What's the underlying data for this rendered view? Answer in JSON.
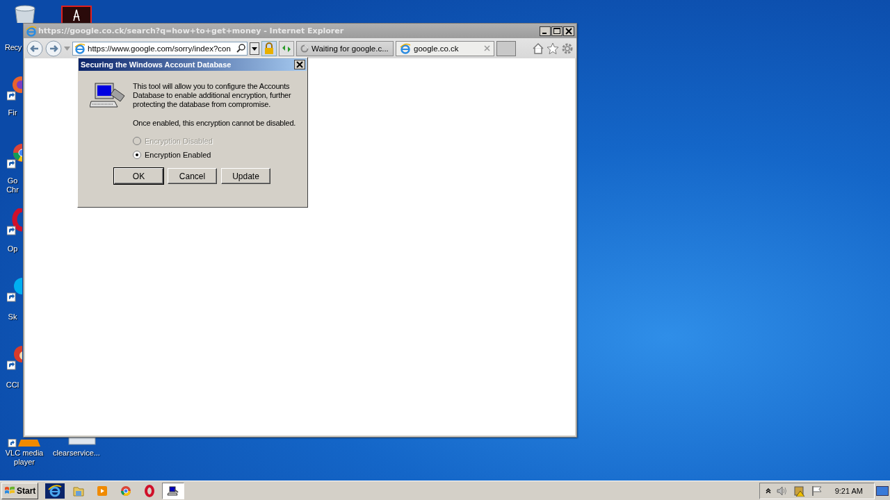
{
  "desktop_icons": [
    {
      "kind": "bin",
      "label": "Recy"
    },
    {
      "kind": "app"
    },
    {
      "kind": "firefox",
      "label": "Fir"
    },
    {
      "kind": "chrome",
      "label": "Go Chr"
    },
    {
      "kind": "opera",
      "label": "Op"
    },
    {
      "kind": "skype",
      "label": "Sk"
    },
    {
      "kind": "ccleaner",
      "label": "CCl"
    },
    {
      "kind": "vlc",
      "label": "VLC media player"
    },
    {
      "kind": "file",
      "label": "clearservice..."
    }
  ],
  "browser": {
    "title": "https://google.co.ck/search?q=how+to+get+money - Internet Explorer",
    "address": "https://www.google.com/sorry/index?con",
    "tabs": [
      {
        "kind": "loading",
        "label": "Waiting for google.c...",
        "selected": false
      },
      {
        "kind": "page",
        "label": "google.co.ck",
        "selected": true
      }
    ]
  },
  "dialog": {
    "title": "Securing the Windows Account Database",
    "paragraphs": [
      "This tool will allow you to configure the Accounts Database to enable additional encryption, further protecting the database from compromise.",
      "Once enabled, this encryption cannot be disabled."
    ],
    "radios": [
      {
        "label": "Encryption Disabled",
        "selected": false,
        "disabled": true
      },
      {
        "label": "Encryption Enabled",
        "selected": true,
        "disabled": false
      }
    ],
    "buttons": [
      {
        "label": "OK",
        "default": true
      },
      {
        "label": "Cancel",
        "default": false
      },
      {
        "label": "Update",
        "default": false
      }
    ]
  },
  "taskbar": {
    "start": "Start",
    "items": [
      {
        "kind": "ie",
        "selected": false
      },
      {
        "kind": "explorer",
        "selected": false
      },
      {
        "kind": "media",
        "selected": false
      },
      {
        "kind": "chrome",
        "selected": false
      },
      {
        "kind": "opera",
        "selected": false
      },
      {
        "kind": "app",
        "selected": true
      }
    ],
    "clock": "9:21 AM"
  }
}
